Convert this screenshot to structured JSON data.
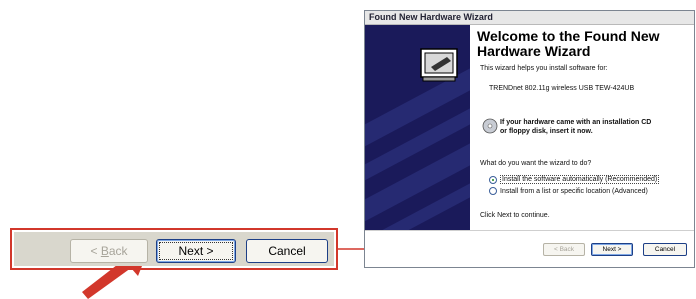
{
  "zoomed_bar": {
    "back_label": "< Back",
    "back_underline": "B",
    "next_label": "Next >",
    "cancel_label": "Cancel"
  },
  "wizard": {
    "title": "Found New Hardware Wizard",
    "heading_line1": "Welcome to the Found New",
    "heading_line2": "Hardware Wizard",
    "intro": "This wizard helps you install software for:",
    "device": "TRENDnet 802.11g wireless USB TEW-424UB",
    "cd_note_line1": "If your hardware came with an installation CD",
    "cd_note_line2": "or floppy disk, insert it now.",
    "question": "What do you want the wizard to do?",
    "options": [
      {
        "label": "Install the software automatically (Recommended)",
        "selected": true
      },
      {
        "label": "Install from a list or specific location (Advanced)",
        "selected": false
      }
    ],
    "continue_text": "Click Next to continue.",
    "buttons": {
      "back": "< Back",
      "next": "Next >",
      "cancel": "Cancel"
    }
  },
  "colors": {
    "highlight_red": "#d2372b",
    "button_border": "#1d3f86",
    "side_panel": "#1a1a5a"
  }
}
